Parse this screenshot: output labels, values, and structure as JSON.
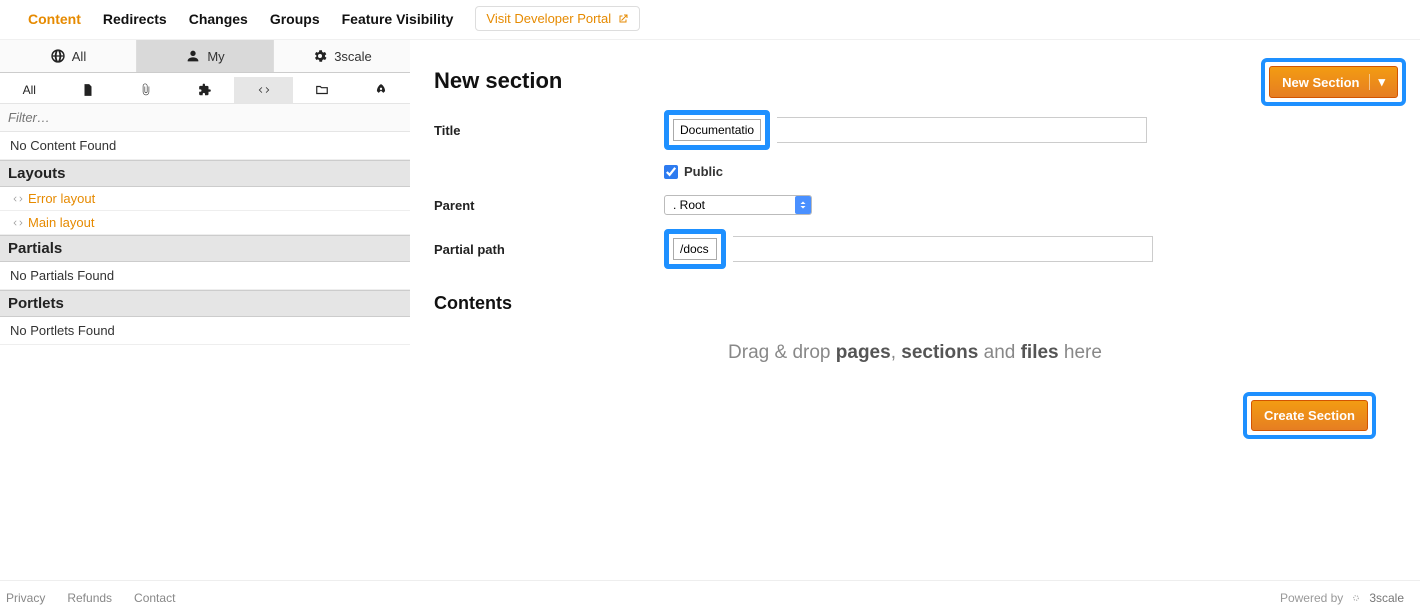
{
  "nav": {
    "items": [
      "Content",
      "Redirects",
      "Changes",
      "Groups",
      "Feature Visibility"
    ],
    "visit_portal": "Visit Developer Portal"
  },
  "sidebar": {
    "scope": {
      "all": "All",
      "my": "My",
      "threescale": "3scale"
    },
    "type_all": "All",
    "filter_placeholder": "Filter…",
    "no_content": "No Content Found",
    "layouts_hdr": "Layouts",
    "layouts": [
      "Error layout",
      "Main layout"
    ],
    "partials_hdr": "Partials",
    "no_partials": "No Partials Found",
    "portlets_hdr": "Portlets",
    "no_portlets": "No Portlets Found"
  },
  "page": {
    "title": "New section",
    "new_section_btn": "New Section",
    "create_section_btn": "Create Section",
    "form": {
      "title_label": "Title",
      "title_value": "Documentation",
      "public_label": "Public",
      "public_checked": true,
      "parent_label": "Parent",
      "parent_value": ". Root",
      "partial_path_label": "Partial path",
      "partial_path_value": "/docs"
    },
    "contents_hdr": "Contents",
    "dropzone_prefix": "Drag & drop ",
    "dropzone_pages": "pages",
    "dropzone_sep1": ", ",
    "dropzone_sections": "sections",
    "dropzone_sep2": " and ",
    "dropzone_files": "files",
    "dropzone_suffix": " here"
  },
  "footer": {
    "links": [
      "Privacy",
      "Refunds",
      "Contact"
    ],
    "powered_by": "Powered by",
    "brand": "3scale"
  }
}
